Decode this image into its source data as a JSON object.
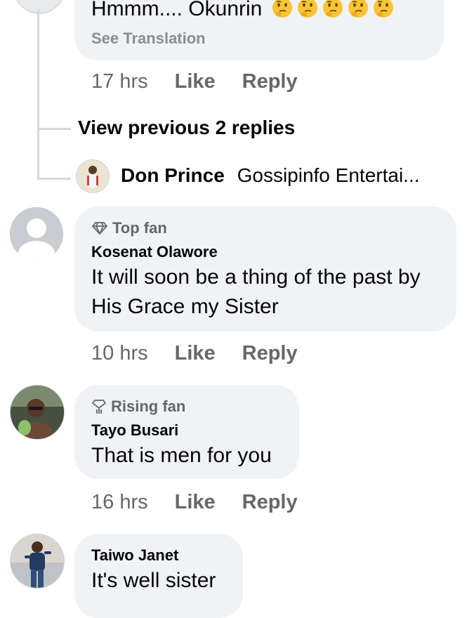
{
  "comments": [
    {
      "text": "Hmmm.... Okunrin",
      "emoji": "thinking-face-emoji",
      "emoji_count": 5,
      "translate": "See Translation",
      "time": "17 hrs",
      "like": "Like",
      "reply": "Reply"
    },
    {
      "badge": "Top fan",
      "badge_icon": "diamond-icon",
      "author": "Kosenat Olawore",
      "text": "It will soon be a thing of the past by His Grace my Sister",
      "time": "10 hrs",
      "like": "Like",
      "reply": "Reply"
    },
    {
      "badge": "Rising fan",
      "badge_icon": "rising-diamond-icon",
      "author": "Tayo Busari",
      "text": "That is men for you",
      "time": "16 hrs",
      "like": "Like",
      "reply": "Reply"
    },
    {
      "author": "Taiwo Janet",
      "text": "It's well sister"
    }
  ],
  "thread": {
    "view_previous": "View previous 2 replies",
    "reply_preview_author": "Don Prince",
    "reply_preview_text": "Gossipinfo Entertai..."
  },
  "colors": {
    "bubble": "#f0f2f5",
    "meta_text": "#65676b",
    "thread_line": "#d5d8dd"
  }
}
